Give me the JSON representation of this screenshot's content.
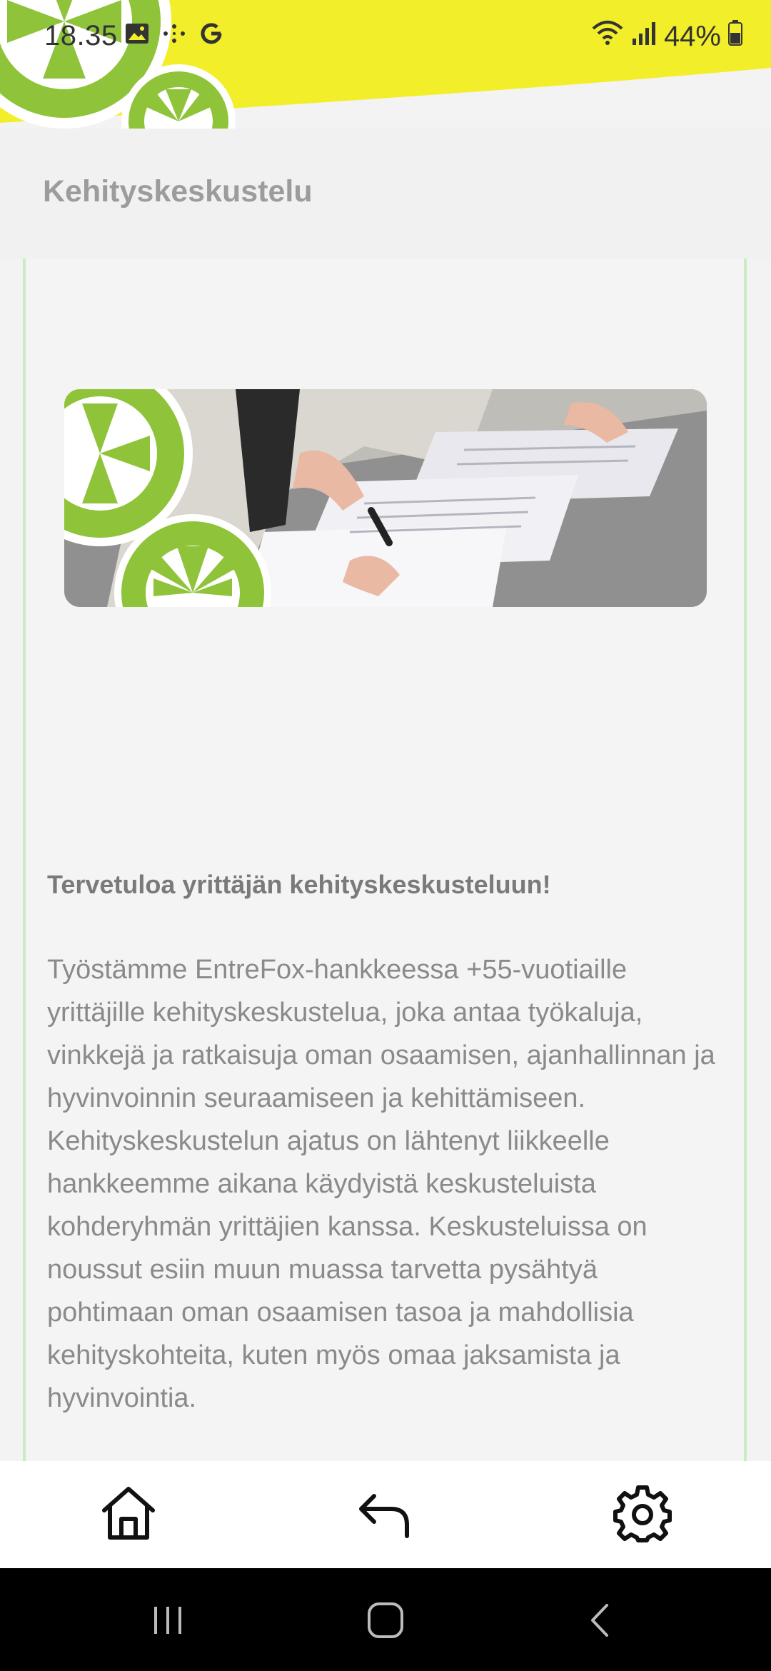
{
  "status_bar": {
    "time": "18.35",
    "battery": "44%",
    "icons": [
      "image-icon",
      "dots-icon",
      "google-icon",
      "wifi-icon",
      "signal-icon",
      "battery-icon"
    ]
  },
  "header": {
    "title": "Kehityskeskustelu"
  },
  "main": {
    "heading": "Tervetuloa yrittäjän kehityskeskusteluun!",
    "body": "Työstämme EntreFox-hankkeessa +55-vuotiaille yrittäjille kehityskeskustelua, joka antaa työkaluja, vinkkejä ja ratkaisuja oman osaamisen, ajanhallinnan ja hyvinvoinnin seuraamiseen ja kehittämiseen. Kehityskeskustelun ajatus on lähtenyt liikkeelle hankkeemme aikana käydyistä keskusteluista kohderyhmän yrittäjien kanssa. Keskusteluissa on noussut esiin muun muassa tarvetta pysähtyä pohtimaan oman osaamisen tasoa ja mahdollisia kehityskohteita, kuten myös omaa jaksamista ja hyvinvointia."
  },
  "bottom_nav": {
    "items": [
      {
        "name": "home",
        "icon": "home-icon"
      },
      {
        "name": "back",
        "icon": "reply-arrow-icon"
      },
      {
        "name": "settings",
        "icon": "gear-icon"
      }
    ]
  },
  "system_nav": {
    "items": [
      "recents-icon",
      "home-circle-icon",
      "back-chevron-icon"
    ]
  },
  "colors": {
    "banner_yellow": "#f2ee2a",
    "flower_green": "#8fc43a",
    "border_green": "#c9ecc3",
    "title_gray": "#9c9c9c",
    "text_gray": "#8a8a8a"
  }
}
